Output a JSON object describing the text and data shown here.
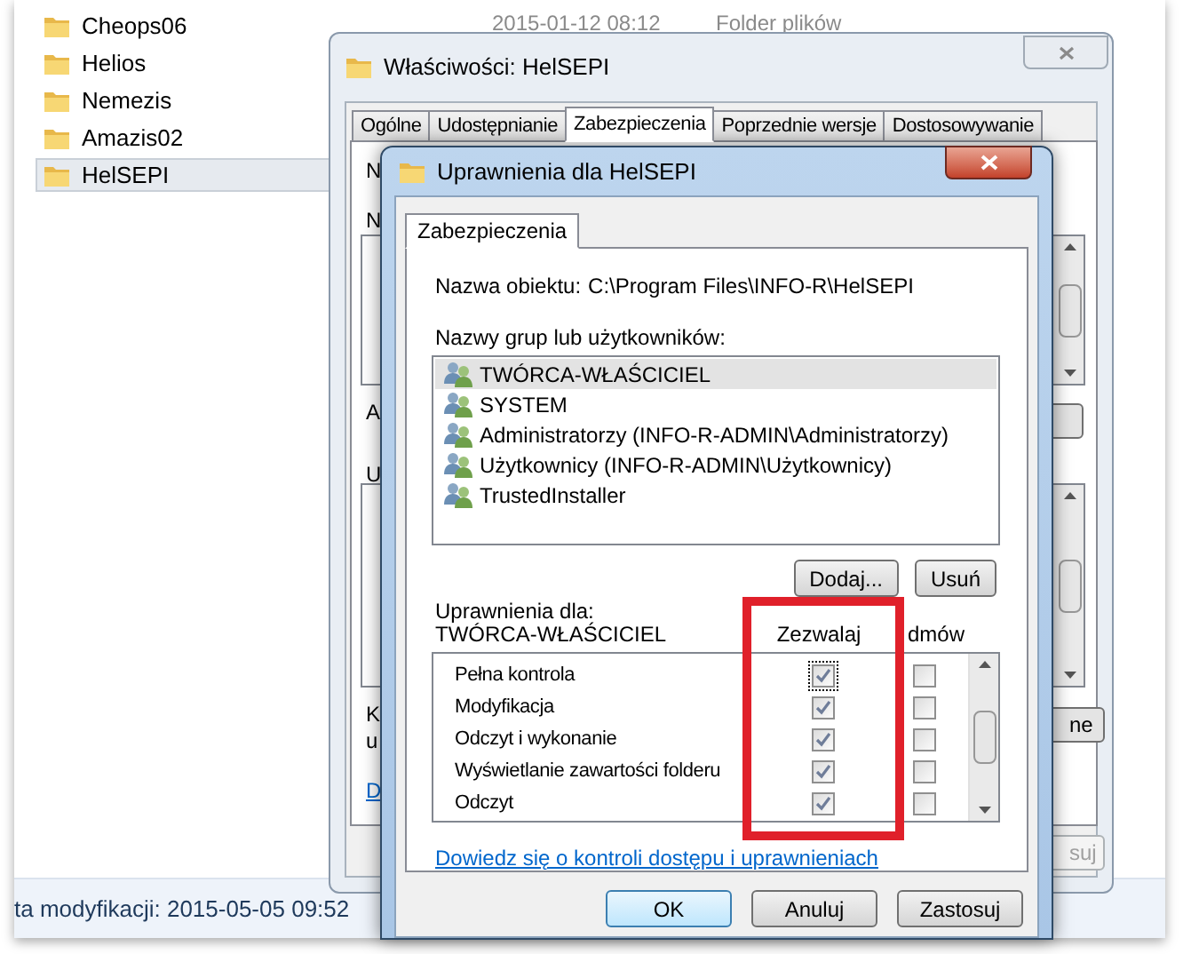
{
  "explorer": {
    "items": [
      {
        "name": "Cheops06",
        "selected": false
      },
      {
        "name": "Helios",
        "selected": false
      },
      {
        "name": "Nemezis",
        "selected": false
      },
      {
        "name": "Amazis02",
        "selected": false
      },
      {
        "name": "HelSEPI",
        "selected": true
      }
    ],
    "covered_row": {
      "date": "2015-01-12 08:12",
      "type": "Folder plików"
    },
    "status": "ta modyfikacji: 2015-05-05 09:52"
  },
  "properties_window": {
    "title": "Właściwości: HelSEPI",
    "tabs": [
      {
        "label": "Ogólne",
        "selected": false
      },
      {
        "label": "Udostępnianie",
        "selected": false
      },
      {
        "label": "Zabezpieczenia",
        "selected": true
      },
      {
        "label": "Poprzednie wersje",
        "selected": false
      },
      {
        "label": "Dostosowywanie",
        "selected": false
      }
    ],
    "left_fragments": [
      {
        "text": "N",
        "kind": "label"
      },
      {
        "text": "N",
        "kind": "label"
      },
      {
        "text": "A",
        "kind": "label"
      },
      {
        "text": "U",
        "kind": "label"
      },
      {
        "text": "K",
        "kind": "label"
      },
      {
        "text": "u",
        "kind": "label"
      },
      {
        "text": "D",
        "kind": "link"
      }
    ],
    "right_fragments": [
      {
        "text": "ne",
        "disabled": false
      },
      {
        "text": "suj",
        "disabled": true
      }
    ]
  },
  "permissions_dialog": {
    "title": "Uprawnienia dla HelSEPI",
    "tab": "Zabezpieczenia",
    "object_label": "Nazwa obiektu:",
    "object_path": "C:\\Program Files\\INFO-R\\HelSEPI",
    "groups_label": "Nazwy grup lub użytkowników:",
    "groups": [
      {
        "name": "TWÓRCA-WŁAŚCICIEL",
        "selected": true
      },
      {
        "name": "SYSTEM",
        "selected": false
      },
      {
        "name": "Administratorzy (INFO-R-ADMIN\\Administratorzy)",
        "selected": false
      },
      {
        "name": "Użytkownicy (INFO-R-ADMIN\\Użytkownicy)",
        "selected": false
      },
      {
        "name": "TrustedInstaller",
        "selected": false
      }
    ],
    "group_buttons": [
      "Dodaj...",
      "Usuń"
    ],
    "permissions_for_label": "Uprawnienia dla:",
    "permissions_for": "TWÓRCA-WŁAŚCICIEL",
    "columns": [
      "Zezwalaj",
      "dmów"
    ],
    "permissions": [
      {
        "name": "Pełna kontrola",
        "allow": true,
        "deny": false,
        "focused": true
      },
      {
        "name": "Modyfikacja",
        "allow": true,
        "deny": false,
        "focused": false
      },
      {
        "name": "Odczyt i wykonanie",
        "allow": true,
        "deny": false,
        "focused": false
      },
      {
        "name": "Wyświetlanie zawartości folderu",
        "allow": true,
        "deny": false,
        "focused": false
      },
      {
        "name": "Odczyt",
        "allow": true,
        "deny": false,
        "focused": false
      }
    ],
    "link": "Dowiedz się o kontroli dostępu i uprawnieniach",
    "buttons": [
      {
        "label": "OK",
        "default": true
      },
      {
        "label": "Anuluj",
        "default": false
      },
      {
        "label": "Zastosuj",
        "default": false
      }
    ]
  }
}
